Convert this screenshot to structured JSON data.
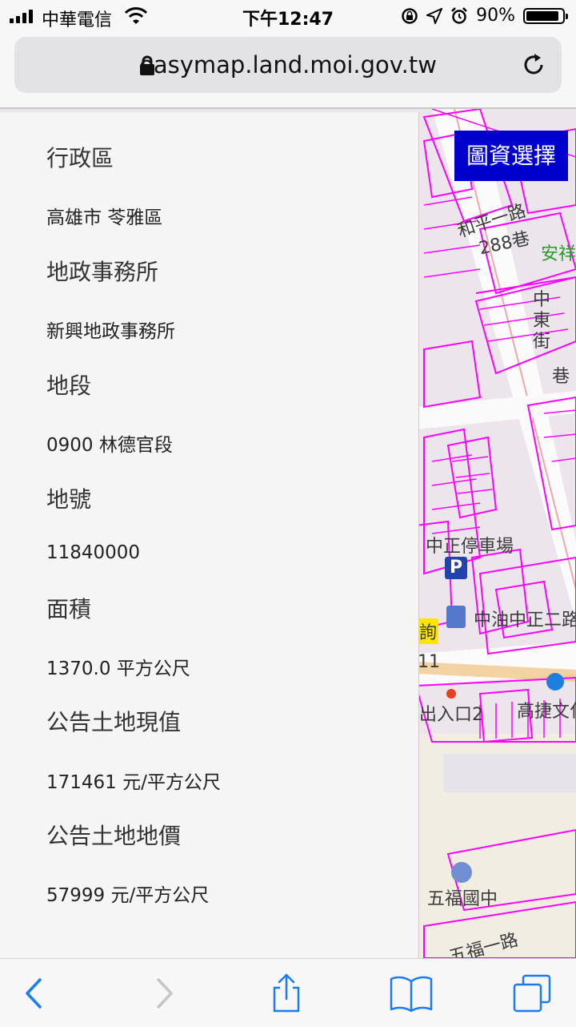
{
  "status": {
    "carrier": "中華電信",
    "time": "下午12:47",
    "battery": "90%",
    "battery_level": 0.9
  },
  "browser": {
    "url": "easymap.land.moi.gov.tw"
  },
  "map": {
    "select_button": "圖資選擇",
    "labels": {
      "road1": "和平一路",
      "lane288": "288巷",
      "anxiang": "安祥",
      "zhongdong": "中東街",
      "lane": "巷",
      "parking": "中正停車場",
      "gas": "中油中正二路",
      "inquiry": "詢",
      "num11": "11",
      "exit2": "出入口2",
      "mrt": "高捷文化",
      "school": "五福國中",
      "road_bottom": "五福一路"
    }
  },
  "panel": {
    "district_label": "行政區",
    "district_value": "高雄市 苓雅區",
    "office_label": "地政事務所",
    "office_value": "新興地政事務所",
    "section_label": "地段",
    "section_value": "0900 林德官段",
    "lot_label": "地號",
    "lot_value": "11840000",
    "area_label": "面積",
    "area_value": "1370.0 平方公尺",
    "land_value_label": "公告土地現值",
    "land_value_value": "171461 元/平方公尺",
    "land_price_label": "公告土地地價",
    "land_price_value": "57999 元/平方公尺"
  },
  "colors": {
    "accent": "#1a7cf5",
    "map_select": "#0000cc",
    "parcel": "#ff00ff"
  }
}
